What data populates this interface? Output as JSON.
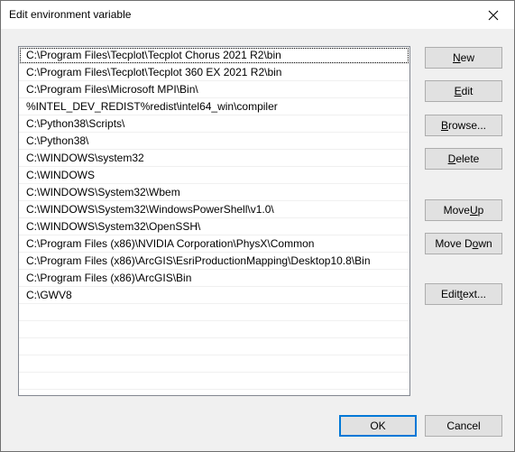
{
  "window": {
    "title": "Edit environment variable"
  },
  "paths": [
    "C:\\Program Files\\Tecplot\\Tecplot Chorus 2021 R2\\bin",
    "C:\\Program Files\\Tecplot\\Tecplot 360 EX 2021 R2\\bin",
    "C:\\Program Files\\Microsoft MPI\\Bin\\",
    "%INTEL_DEV_REDIST%redist\\intel64_win\\compiler",
    "C:\\Python38\\Scripts\\",
    "C:\\Python38\\",
    "C:\\WINDOWS\\system32",
    "C:\\WINDOWS",
    "C:\\WINDOWS\\System32\\Wbem",
    "C:\\WINDOWS\\System32\\WindowsPowerShell\\v1.0\\",
    "C:\\WINDOWS\\System32\\OpenSSH\\",
    "C:\\Program Files (x86)\\NVIDIA Corporation\\PhysX\\Common",
    "C:\\Program Files (x86)\\ArcGIS\\EsriProductionMapping\\Desktop10.8\\Bin",
    "C:\\Program Files (x86)\\ArcGIS\\Bin",
    "C:\\GWV8",
    "",
    "",
    "",
    "",
    ""
  ],
  "buttons": {
    "new": {
      "pre": "",
      "key": "N",
      "post": "ew"
    },
    "edit": {
      "pre": "",
      "key": "E",
      "post": "dit"
    },
    "browse": {
      "pre": "",
      "key": "B",
      "post": "rowse..."
    },
    "delete": {
      "pre": "",
      "key": "D",
      "post": "elete"
    },
    "move_up": {
      "pre": "Move ",
      "key": "U",
      "post": "p"
    },
    "move_down": {
      "pre": "Move D",
      "key": "o",
      "post": "wn"
    },
    "edit_text": {
      "pre": "Edit ",
      "key": "t",
      "post": "ext..."
    },
    "ok": "OK",
    "cancel": "Cancel"
  },
  "colors": {
    "accent": "#0078d7",
    "button_face": "#e1e1e1",
    "dialog_bg": "#f0f0f0"
  }
}
